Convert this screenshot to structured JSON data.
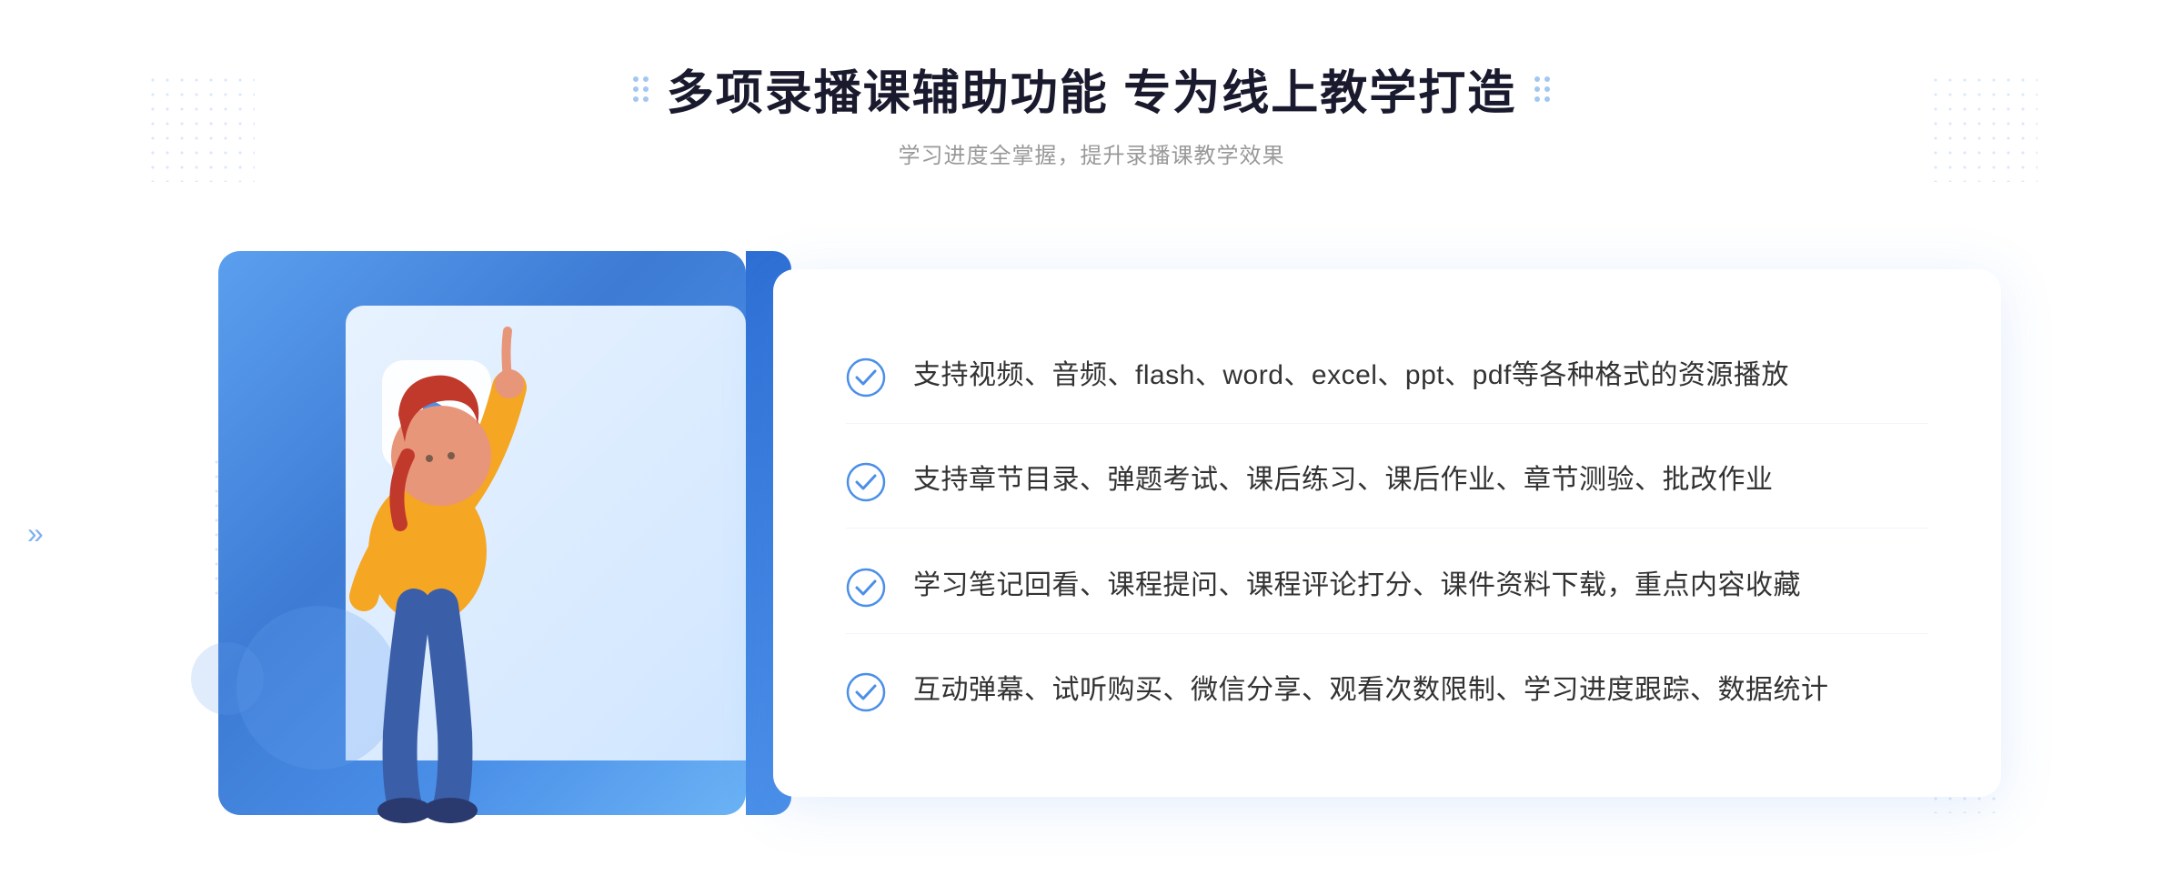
{
  "header": {
    "main_title": "多项录播课辅助功能 专为线上教学打造",
    "subtitle": "学习进度全掌握，提升录播课教学效果"
  },
  "features": [
    {
      "id": 1,
      "text": "支持视频、音频、flash、word、excel、ppt、pdf等各种格式的资源播放"
    },
    {
      "id": 2,
      "text": "支持章节目录、弹题考试、课后练习、课后作业、章节测验、批改作业"
    },
    {
      "id": 3,
      "text": "学习笔记回看、课程提问、课程评论打分、课件资料下载，重点内容收藏"
    },
    {
      "id": 4,
      "text": "互动弹幕、试听购买、微信分享、观看次数限制、学习进度跟踪、数据统计"
    }
  ],
  "icons": {
    "check_circle": "check-circle-icon",
    "play": "play-icon",
    "chevron": "chevron-right-icon"
  },
  "colors": {
    "primary_blue": "#4a8fe8",
    "dark_blue": "#2e6fd4",
    "light_blue": "#e8f2ff",
    "title_dark": "#1a1a2e",
    "text_gray": "#333333",
    "subtitle_gray": "#999999"
  }
}
